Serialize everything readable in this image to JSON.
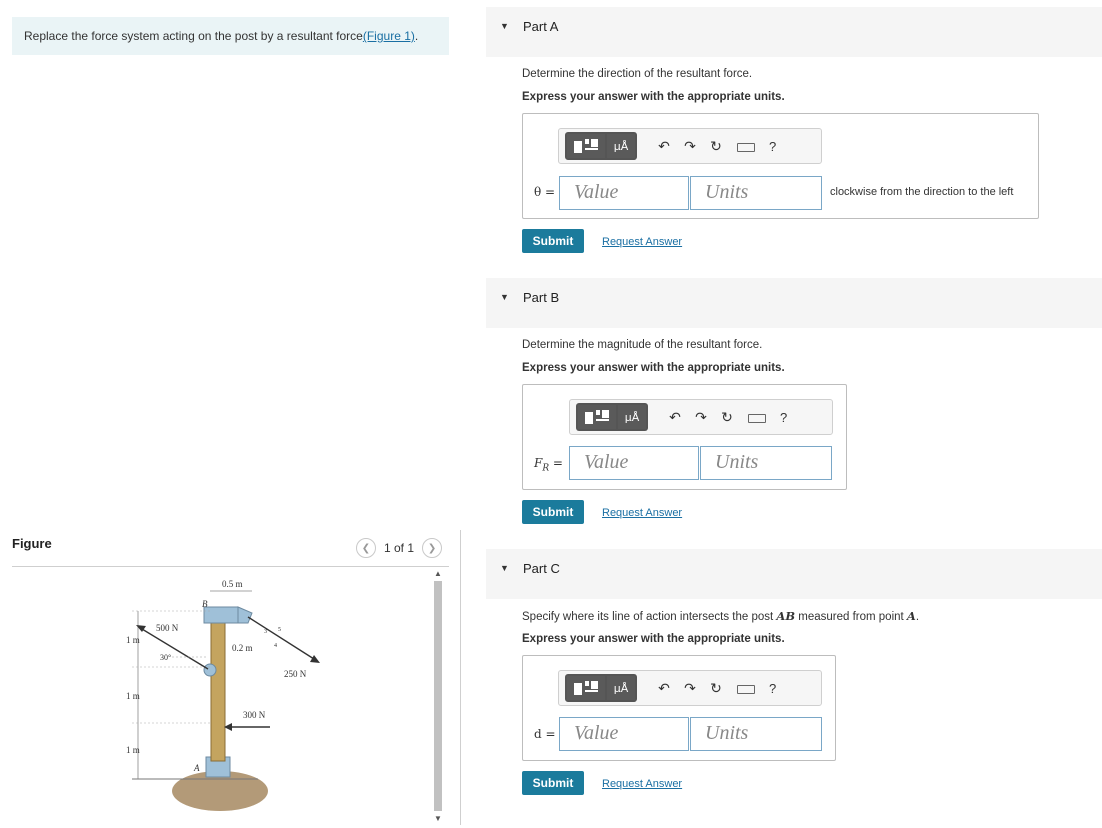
{
  "problem": {
    "text": "Replace the force system acting on the post by a resultant force",
    "link": "(Figure 1)",
    "period": "."
  },
  "figure": {
    "label": "Figure",
    "pager": "1 of 1",
    "dims": {
      "top_width": "0.5 m",
      "arm_len": "0.2 m",
      "seg1": "1 m",
      "seg2": "1 m",
      "seg3": "1 m",
      "angle": "30°"
    },
    "forces": {
      "f500": "500 N",
      "f250": "250 N",
      "f300": "300 N"
    },
    "points": {
      "a": "A",
      "b": "B"
    },
    "slope": {
      "three": "3",
      "four": "4",
      "five": "5"
    }
  },
  "toolbar": {
    "mu_label": "μÅ",
    "undo_icon": "undo-icon",
    "redo_icon": "redo-icon",
    "reset_icon": "reset-icon",
    "keyboard_icon": "keyboard-icon",
    "help": "?"
  },
  "parts": [
    {
      "title": "Part A",
      "question": "Determine the direction of the resultant force.",
      "instructions": "Express your answer with the appropriate units.",
      "var": "θ =",
      "value_placeholder": "Value",
      "units_placeholder": "Units",
      "unit_note": "clockwise from the direction to the left",
      "submit": "Submit",
      "request": "Request Answer"
    },
    {
      "title": "Part B",
      "question": "Determine the magnitude of the resultant force.",
      "instructions": "Express your answer with the appropriate units.",
      "var_main": "F",
      "var_sub": "R",
      "var_eq": " =",
      "value_placeholder": "Value",
      "units_placeholder": "Units",
      "submit": "Submit",
      "request": "Request Answer"
    },
    {
      "title": "Part C",
      "question_pre": "Specify where its line of action intersects the post ",
      "question_ab": "AB",
      "question_mid": " measured from point ",
      "question_a": "A",
      "question_end": ".",
      "instructions": "Express your answer with the appropriate units.",
      "var": "d =",
      "value_placeholder": "Value",
      "units_placeholder": "Units",
      "submit": "Submit",
      "request": "Request Answer"
    }
  ],
  "colors": {
    "accent": "#1b7b9c",
    "link": "#1a6fa3",
    "problem_bg": "#eaf4f6",
    "part_bg": "#f5f5f5"
  }
}
